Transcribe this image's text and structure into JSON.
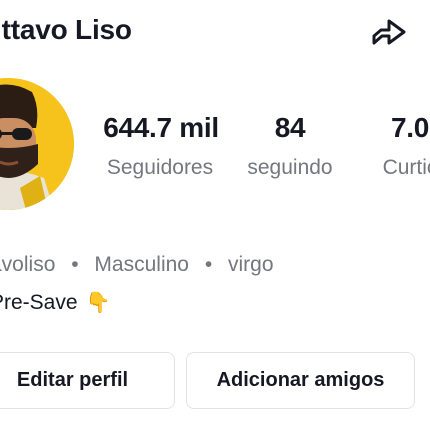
{
  "profile": {
    "name": "ıttavo Liso",
    "meta": {
      "username": "avoliso",
      "gender": "Masculino",
      "sign": "virgo",
      "separator": "•"
    },
    "bio": {
      "text": "Pre-Save",
      "emoji": "👇"
    }
  },
  "stats": [
    {
      "value": "644.7 mil",
      "label": "Seguidores"
    },
    {
      "value": "84",
      "label": "seguindo"
    },
    {
      "value": "7.0",
      "label": "Curtic"
    }
  ],
  "actions": {
    "edit_label": "Editar perfil",
    "add_friends_label": "Adicionar amigos"
  },
  "icons": {
    "share": "share-arrow-icon"
  },
  "colors": {
    "text": "#161823",
    "secondary": "#75777f",
    "button_border": "#e3e3e6",
    "avatar_background": "#f6c21c"
  }
}
